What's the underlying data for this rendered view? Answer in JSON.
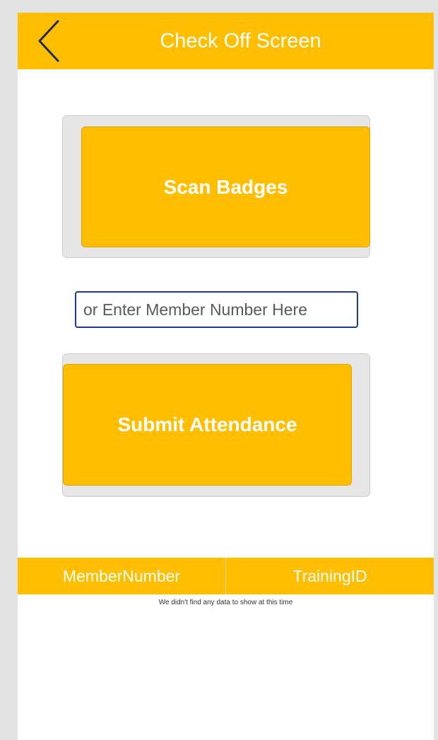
{
  "app": {
    "title": "Check Off Screen",
    "back_icon": "chevron-left-icon"
  },
  "main": {
    "scan_button_label": "Scan Badges",
    "member_input": {
      "value": "",
      "placeholder": "or Enter Member Number Here"
    },
    "submit_button_label": "Submit Attendance"
  },
  "table": {
    "columns": [
      "MemberNumber",
      "TrainingID"
    ],
    "empty_message": "We didn't find any data to show at this time"
  },
  "colors": {
    "accent": "#ffbf00",
    "header_text": "#ffffff",
    "back_icon": "#1f2a5c",
    "input_border": "#1f3a93"
  }
}
